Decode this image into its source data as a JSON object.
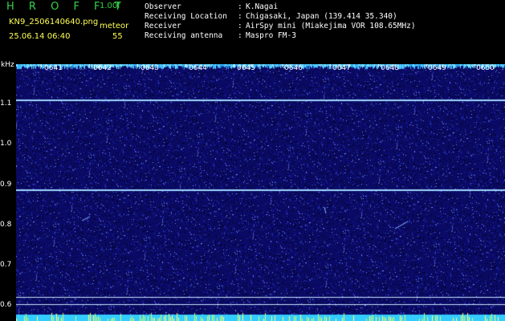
{
  "header": {
    "app_title": "H R O F F T",
    "version": "1.00f",
    "filename": "KN9_2506140640.png",
    "mode_label": "meteor",
    "datetime": "25.06.14 06:40",
    "count": "55"
  },
  "meta": [
    {
      "label": "Observer",
      "sep": ":",
      "value": "K.Nagai"
    },
    {
      "label": "Receiving Location",
      "sep": ":",
      "value": "Chigasaki, Japan (139.414 35.340)"
    },
    {
      "label": "Receiver",
      "sep": ":",
      "value": "AirSpy mini (Miakejima VOR 108.65MHz)"
    },
    {
      "label": "Receiving antenna",
      "sep": ":",
      "value": "Maspro FM-3"
    }
  ],
  "axis": {
    "unit": "kHz",
    "y_ticks": [
      "1.1",
      "1.0",
      "0.9",
      "0.8",
      "0.7",
      "0.6"
    ],
    "x_ticks": [
      "0641",
      "0642",
      "0643",
      "0644",
      "0645",
      "0646",
      "0647",
      "0648",
      "0649",
      "0650"
    ]
  },
  "colors": {
    "background": "#000000",
    "plot_background": "#0a0a5c",
    "carrier_line": "#9fd8ff",
    "bottom_band": "#33ccff",
    "header_green": "#36d24a",
    "header_yellow": "#ffff55"
  }
}
